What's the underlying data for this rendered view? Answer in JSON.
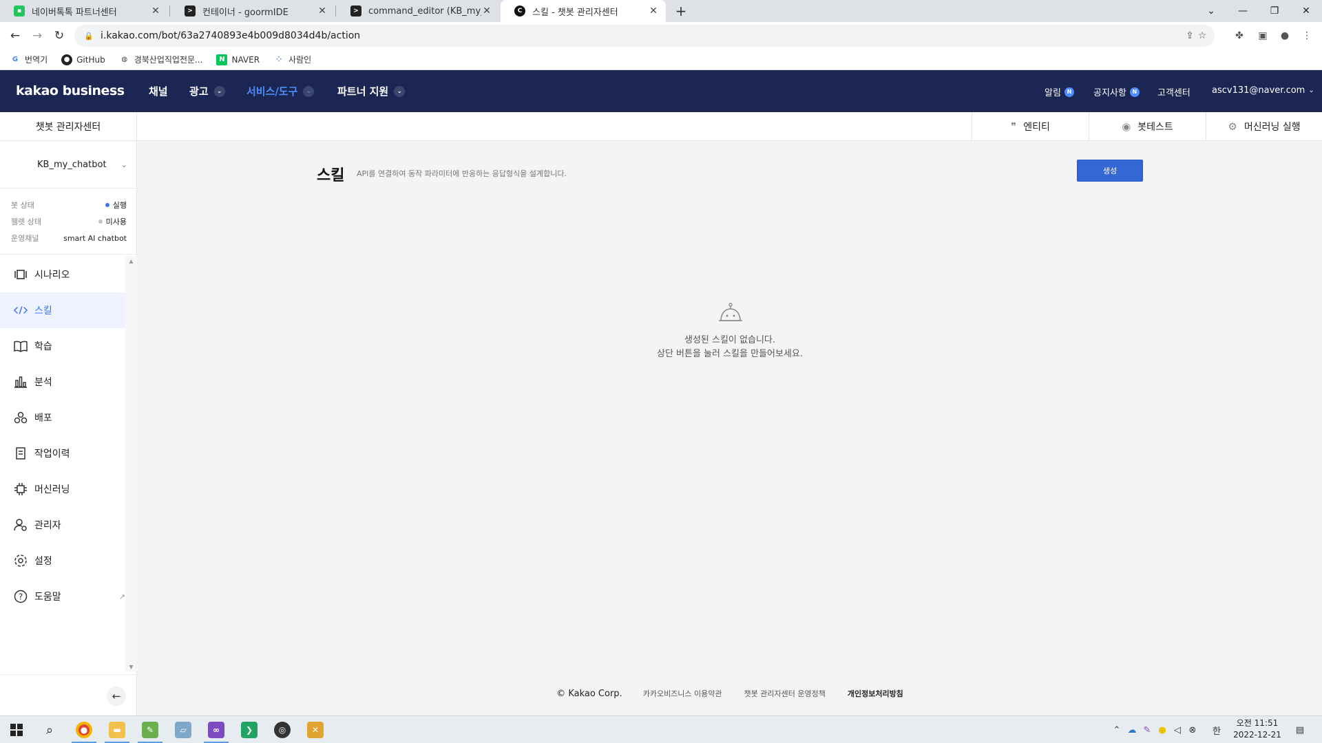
{
  "browser": {
    "tabs": [
      {
        "title": "네이버톡톡 파트너센터",
        "active": false
      },
      {
        "title": "컨테이너 - goormIDE",
        "active": false
      },
      {
        "title": "command_editor (KB_my_chatbo",
        "active": false
      },
      {
        "title": "스킬 - 챗봇 관리자센터",
        "active": true
      }
    ],
    "url": "i.kakao.com/bot/63a2740893e4b009d8034d4b/action",
    "bookmarks": [
      {
        "label": "번역기",
        "icon": "google-icon"
      },
      {
        "label": "GitHub",
        "icon": "github-icon"
      },
      {
        "label": "경북산업직업전문...",
        "icon": "globe-icon"
      },
      {
        "label": "NAVER",
        "icon": "naver-icon"
      },
      {
        "label": "사람인",
        "icon": "saramin-icon"
      }
    ]
  },
  "header": {
    "logo": "kakao business",
    "nav": [
      {
        "label": "채널",
        "dropdown": false,
        "active": false
      },
      {
        "label": "광고",
        "dropdown": true,
        "active": false
      },
      {
        "label": "서비스/도구",
        "dropdown": true,
        "active": true
      },
      {
        "label": "파트너 지원",
        "dropdown": true,
        "active": false
      }
    ],
    "right": {
      "alarm": "알림",
      "notice": "공지사항",
      "badge": "N",
      "support": "고객센터",
      "account": "ascv131@naver.com"
    },
    "accent": "#4d8dff",
    "background": "#1b2653"
  },
  "subheader": {
    "center_title": "챗봇 관리자센터",
    "tools": [
      {
        "label": "엔티티",
        "icon": "quote-icon"
      },
      {
        "label": "봇테스트",
        "icon": "chat-bubble-icon"
      },
      {
        "label": "머신러닝 실행",
        "icon": "gear-icon"
      }
    ]
  },
  "sidebar": {
    "bot_name": "KB_my_chatbot",
    "status": [
      {
        "label": "봇 상태",
        "value": "실행",
        "dot": "#3b73f0"
      },
      {
        "label": "웰렛 상태",
        "value": "미사용",
        "dot": "#c4c4c4"
      },
      {
        "label": "운영채널",
        "value": "smart AI chatbot",
        "dot": ""
      }
    ],
    "menu": [
      {
        "label": "시나리오",
        "icon": "scenario-icon",
        "active": false
      },
      {
        "label": "스킬",
        "icon": "code-icon",
        "active": true
      },
      {
        "label": "학습",
        "icon": "book-icon",
        "active": false
      },
      {
        "label": "분석",
        "icon": "bar-chart-icon",
        "active": false
      },
      {
        "label": "배포",
        "icon": "deploy-icon",
        "active": false
      },
      {
        "label": "작업이력",
        "icon": "history-icon",
        "active": false
      },
      {
        "label": "머신러닝",
        "icon": "chip-icon",
        "active": false
      },
      {
        "label": "관리자",
        "icon": "user-gear-icon",
        "active": false
      },
      {
        "label": "설정",
        "icon": "settings-icon",
        "active": false
      },
      {
        "label": "도움말",
        "icon": "help-icon",
        "active": false
      }
    ]
  },
  "main": {
    "title": "스킬",
    "description": "API를 연결하여 동작 파라미터에 반응하는 응답형식을 설계합니다.",
    "create_button": "생성",
    "empty_line1": "생성된 스킬이 없습니다.",
    "empty_line2": "상단 버튼을 눌러 스킬을 만들어보세요.",
    "primary_color": "#3566d6"
  },
  "footer": {
    "copyright": "© Kakao Corp.",
    "links": [
      "카카오비즈니스 이용약관",
      "챗봇 관리자센터 운영정책",
      "개인정보처리방침"
    ]
  },
  "taskbar": {
    "time": "오전 11:51",
    "date": "2022-12-21",
    "ime": "한"
  }
}
